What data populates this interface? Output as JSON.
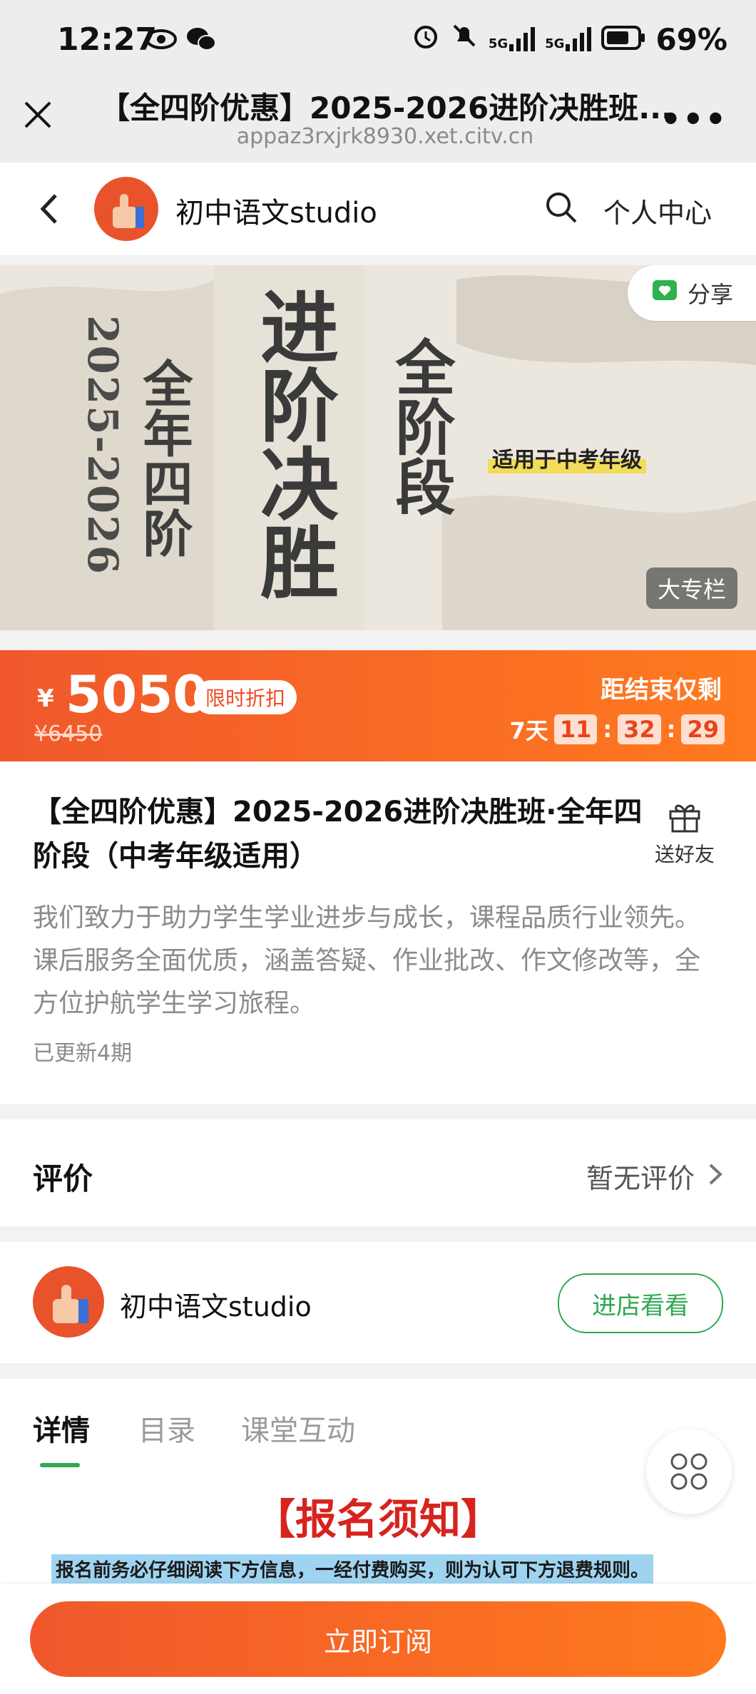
{
  "status_bar": {
    "time": "12:27",
    "network1": "5G",
    "network2": "5G",
    "battery": "69%"
  },
  "browser": {
    "title": "【全四阶优惠】2025-2026进阶决胜班...",
    "url": "appaz3rxjrk8930.xet.citv.cn",
    "more": "•••"
  },
  "nav": {
    "shop_name": "初中语文studio",
    "personal_center": "个人中心"
  },
  "banner": {
    "share_label": "分享",
    "year_text": "2025-2026",
    "stage_text": "全年四阶",
    "main_text": "进阶决胜",
    "all_stage_text": "全阶段",
    "tag_text": "适用于中考年级",
    "column_tag": "大专栏"
  },
  "price": {
    "currency": "¥",
    "value": "5050",
    "badge": "限时折扣",
    "original": "¥6450",
    "countdown_label": "距结束仅剩",
    "days": "7天",
    "hours": "11",
    "minutes": "32",
    "seconds": "29",
    "sep": ":"
  },
  "info": {
    "title": "【全四阶优惠】2025-2026进阶决胜班·全年四阶段（中考年级适用）",
    "gift_label": "送好友",
    "description": "我们致力于助力学生学业进步与成长，课程品质行业领先。课后服务全面优质，涵盖答疑、作业批改、作文修改等，全方位护航学生学习旅程。",
    "updated": "已更新4期"
  },
  "review": {
    "label": "评价",
    "value": "暂无评价"
  },
  "shop": {
    "name": "初中语文studio",
    "button": "进店看看"
  },
  "tabs": [
    {
      "label": "详情"
    },
    {
      "label": "目录"
    },
    {
      "label": "课堂互动"
    }
  ],
  "notice": {
    "title": "【报名须知】",
    "line1": "报名前务必仔细阅读下方信息，一经付费购买，则为认可下方退费规则。"
  },
  "cta": {
    "label": "立即订阅"
  },
  "colors": {
    "accent_orange": "#f0582c",
    "accent_green": "#2fa84f",
    "notice_red": "#d7231e"
  }
}
